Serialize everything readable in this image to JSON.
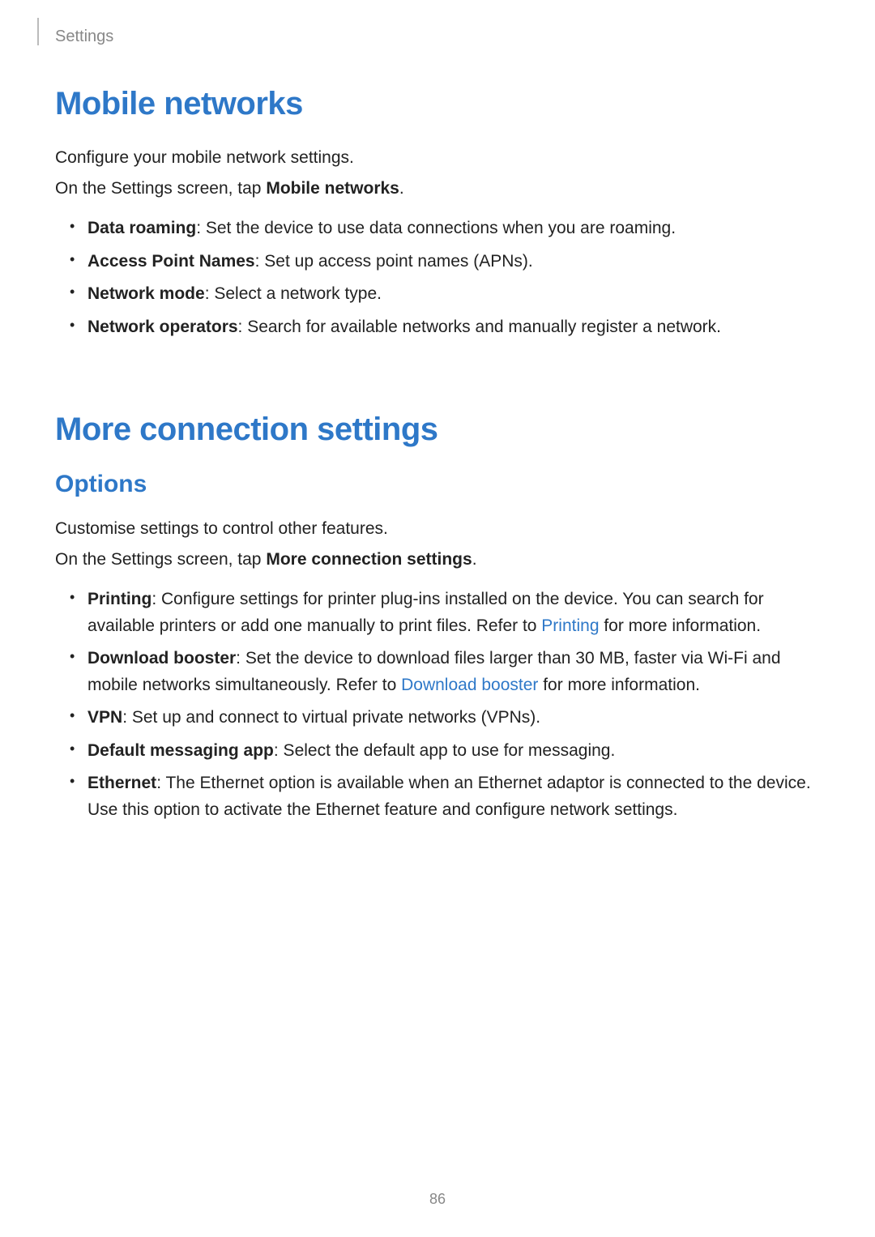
{
  "header": {
    "section_label": "Settings"
  },
  "sections": {
    "mobile_networks": {
      "title": "Mobile networks",
      "intro1": "Configure your mobile network settings.",
      "intro2_prefix": "On the Settings screen, tap ",
      "intro2_bold": "Mobile networks",
      "intro2_suffix": ".",
      "items": [
        {
          "term": "Data roaming",
          "desc": ": Set the device to use data connections when you are roaming."
        },
        {
          "term": "Access Point Names",
          "desc": ": Set up access point names (APNs)."
        },
        {
          "term": "Network mode",
          "desc": ": Select a network type."
        },
        {
          "term": "Network operators",
          "desc": ": Search for available networks and manually register a network."
        }
      ]
    },
    "more_connection": {
      "title": "More connection settings",
      "subtitle": "Options",
      "intro1": "Customise settings to control other features.",
      "intro2_prefix": "On the Settings screen, tap ",
      "intro2_bold": "More connection settings",
      "intro2_suffix": ".",
      "items": {
        "printing": {
          "term": "Printing",
          "desc_before_link": ": Configure settings for printer plug-ins installed on the device. You can search for available printers or add one manually to print files. Refer to ",
          "link": "Printing",
          "desc_after_link": " for more information."
        },
        "download_booster": {
          "term": "Download booster",
          "desc_before_link": ": Set the device to download files larger than 30 MB, faster via Wi-Fi and mobile networks simultaneously. Refer to ",
          "link": "Download booster",
          "desc_after_link": " for more information."
        },
        "vpn": {
          "term": "VPN",
          "desc": ": Set up and connect to virtual private networks (VPNs)."
        },
        "default_messaging": {
          "term": "Default messaging app",
          "desc": ": Select the default app to use for messaging."
        },
        "ethernet": {
          "term": "Ethernet",
          "desc": ": The Ethernet option is available when an Ethernet adaptor is connected to the device. Use this option to activate the Ethernet feature and configure network settings."
        }
      }
    }
  },
  "page_number": "86"
}
